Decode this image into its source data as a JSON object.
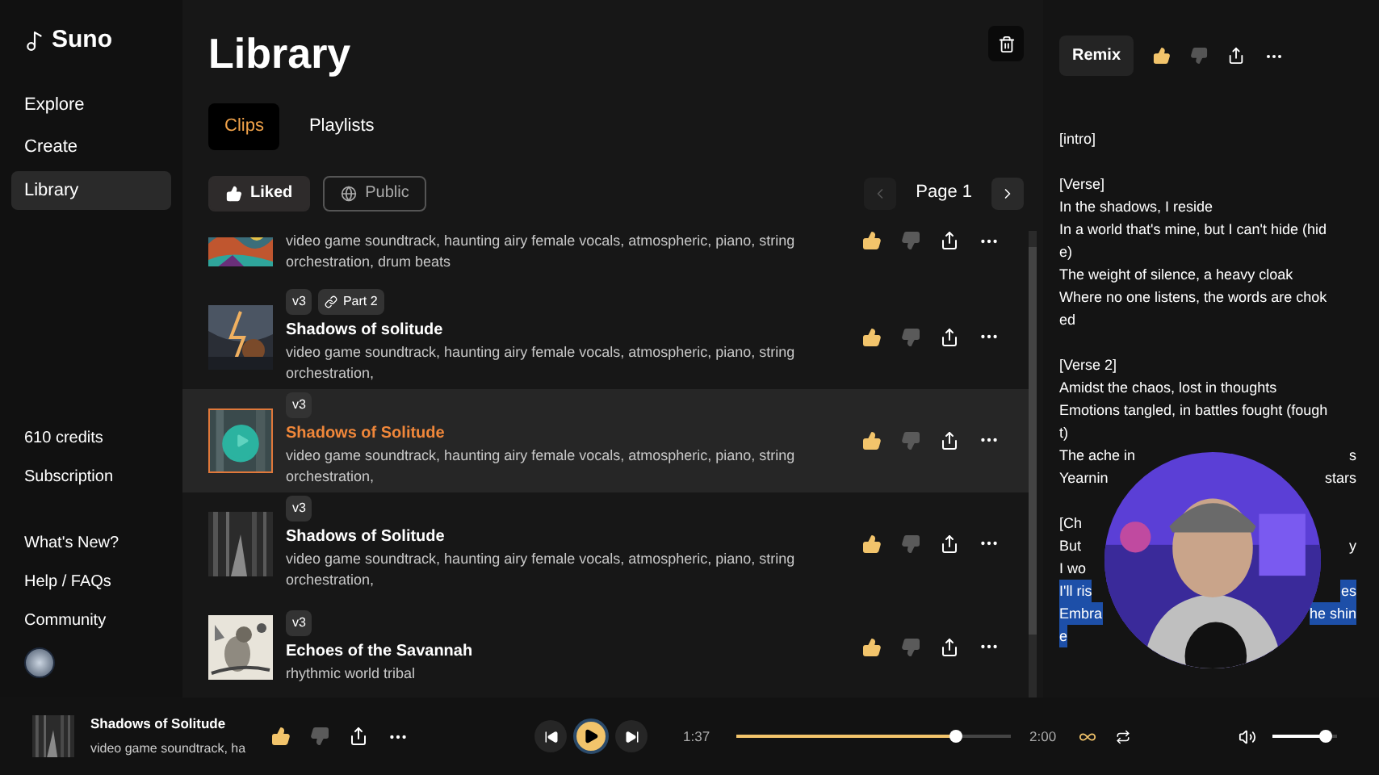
{
  "sidebar": {
    "logo": "Suno",
    "nav": [
      {
        "label": "Explore",
        "selected": false
      },
      {
        "label": "Create",
        "selected": false
      },
      {
        "label": "Library",
        "selected": true
      }
    ],
    "credits": "610 credits",
    "links": [
      "Subscription",
      "What's New?",
      "Help / FAQs",
      "Community"
    ]
  },
  "header": {
    "title": "Library"
  },
  "tabs": [
    {
      "label": "Clips",
      "selected": true
    },
    {
      "label": "Playlists",
      "selected": false
    }
  ],
  "filters": [
    {
      "label": "Liked",
      "selected": true,
      "kind": "like"
    },
    {
      "label": "Public",
      "selected": false,
      "kind": "globe"
    }
  ],
  "pagination": {
    "label": "Page 1",
    "prev_disabled": true
  },
  "clips": [
    {
      "partial": true,
      "selected": false,
      "liked": true,
      "description": "video game soundtrack, haunting airy female vocals, atmospheric, piano, string orchestration, drum beats"
    },
    {
      "partial": false,
      "selected": false,
      "liked": true,
      "tags": [
        {
          "label": "v3",
          "kind": "plain"
        },
        {
          "label": "Part 2",
          "kind": "link"
        }
      ],
      "title": "Shadows of solitude",
      "description": "video game soundtrack, haunting airy female vocals, atmospheric, piano, string orchestration,"
    },
    {
      "partial": false,
      "selected": true,
      "liked": true,
      "tags": [
        {
          "label": "v3",
          "kind": "plain"
        }
      ],
      "title": "Shadows of Solitude",
      "description": "video game soundtrack, haunting airy female vocals, atmospheric, piano, string orchestration,"
    },
    {
      "partial": false,
      "selected": false,
      "liked": true,
      "tags": [
        {
          "label": "v3",
          "kind": "plain"
        }
      ],
      "title": "Shadows of Solitude",
      "description": "video game soundtrack, haunting airy female vocals, atmospheric, piano, string orchestration,"
    },
    {
      "partial": false,
      "selected": false,
      "liked": true,
      "tags": [
        {
          "label": "v3",
          "kind": "plain"
        }
      ],
      "title": "Echoes of the Savannah",
      "description": "rhythmic world tribal"
    }
  ],
  "details": {
    "remix": "Remix",
    "liked": true,
    "lyrics": [
      [
        {
          "text": "[intro]",
          "highlighted": false
        }
      ],
      [
        {
          "text": "[Verse]",
          "highlighted": false
        },
        {
          "text": "In the shadows, I reside",
          "highlighted": false
        },
        {
          "text": "In a world that's mine, but I can't hide (hid",
          "highlighted": false
        },
        {
          "text": "e)",
          "highlighted": false
        },
        {
          "text": "The weight of silence, a heavy cloak",
          "highlighted": false
        },
        {
          "text": "Where no one listens, the words are chok",
          "highlighted": false
        },
        {
          "text": "ed",
          "highlighted": false
        }
      ],
      [
        {
          "text": "[Verse 2]",
          "highlighted": false
        },
        {
          "text": "Amidst the chaos, lost in thoughts",
          "highlighted": false
        },
        {
          "text": "Emotions tangled, in battles fought (fough",
          "highlighted": false
        },
        {
          "text": "t)",
          "highlighted": false
        },
        {
          "text": "The ache in",
          "tail": "s",
          "highlighted": false
        },
        {
          "text": "Yearnin",
          "tail": "stars",
          "highlighted": false
        }
      ],
      [
        {
          "text": "[Ch",
          "highlighted": false
        },
        {
          "text": "But",
          "tail": "y",
          "highlighted": false
        },
        {
          "text": "I wo",
          "highlighted": false
        },
        {
          "text": "I'll ris",
          "tail": "es",
          "highlighted": true
        },
        {
          "text": "Embra",
          "tail": "he shin",
          "highlighted": true
        },
        {
          "text": "e",
          "highlighted": true
        }
      ]
    ]
  },
  "player": {
    "title": "Shadows of Solitude",
    "description": "video game soundtrack, ha",
    "liked": true,
    "elapsed": "1:37",
    "level": 0.8,
    "duration": "2:00",
    "loop": true,
    "volume": {
      "level": 0.9
    }
  }
}
